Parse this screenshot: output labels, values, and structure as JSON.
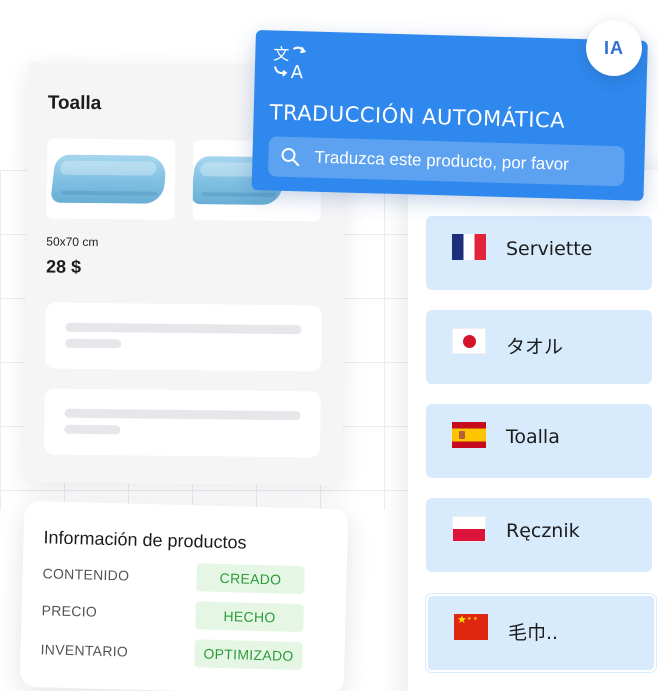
{
  "product": {
    "title": "Toalla",
    "size": "50x70 cm",
    "price": "28 $"
  },
  "product_info": {
    "title": "Información de productos",
    "rows": [
      {
        "label": "CONTENIDO",
        "status": "CREADO"
      },
      {
        "label": "PRECIO",
        "status": "HECHO"
      },
      {
        "label": "INVENTARIO",
        "status": "OPTIMIZADO"
      }
    ]
  },
  "translation": {
    "title": "TRADUCCIÓN AUTOMÁTICA",
    "search_text": "Traduzca este producto, por favor",
    "badge": "IA"
  },
  "languages": [
    {
      "flag": "france-flag",
      "word": "Serviette"
    },
    {
      "flag": "japan-flag",
      "word": "タオル"
    },
    {
      "flag": "spain-flag",
      "word": "Toalla"
    },
    {
      "flag": "poland-flag",
      "word": "Ręcznik"
    },
    {
      "flag": "china-flag",
      "word": "毛巾.."
    }
  ],
  "colors": {
    "accent_blue": "#2f88ed",
    "language_item_bg": "#d8ebfd",
    "badge_green_text": "#2f9a3c",
    "badge_green_bg": "#e5f7e4"
  }
}
